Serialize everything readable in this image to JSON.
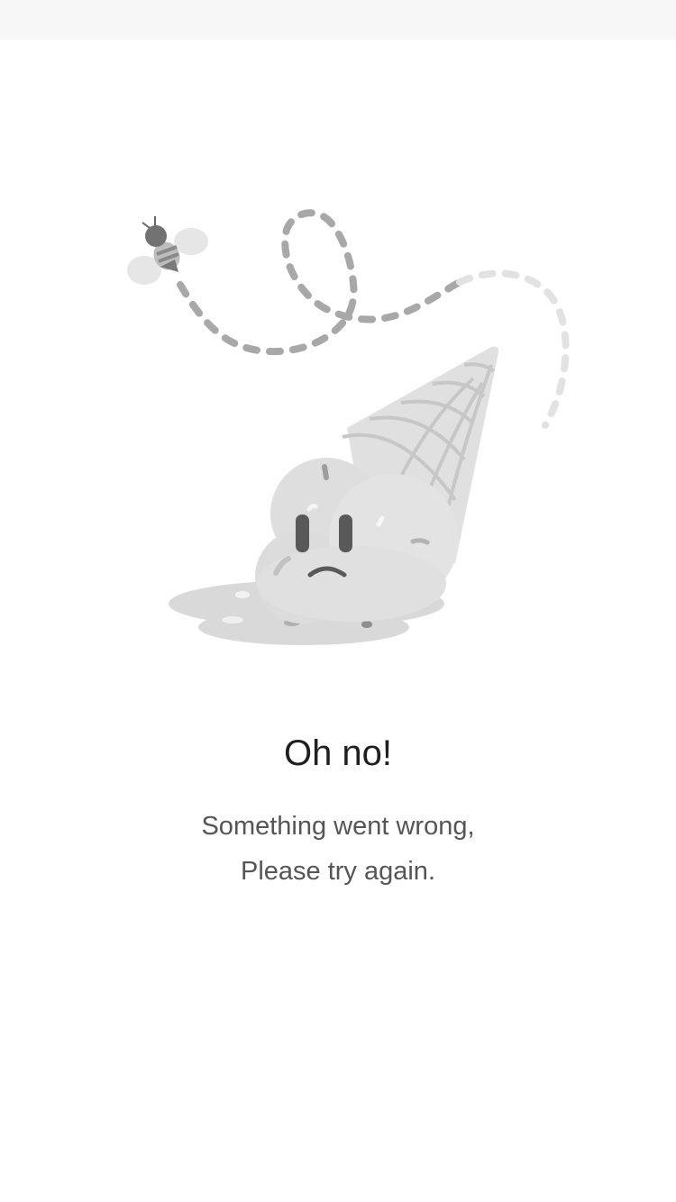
{
  "status_bar": {
    "background": "#f7f7f7"
  },
  "illustration": {
    "icon": "melted-ice-cream-with-bee-icon"
  },
  "error": {
    "title": "Oh no!",
    "message_line1": "Something went wrong,",
    "message_line2": "Please try again."
  },
  "colors": {
    "title": "#1f1f1f",
    "message": "#555555",
    "background": "#ffffff"
  }
}
